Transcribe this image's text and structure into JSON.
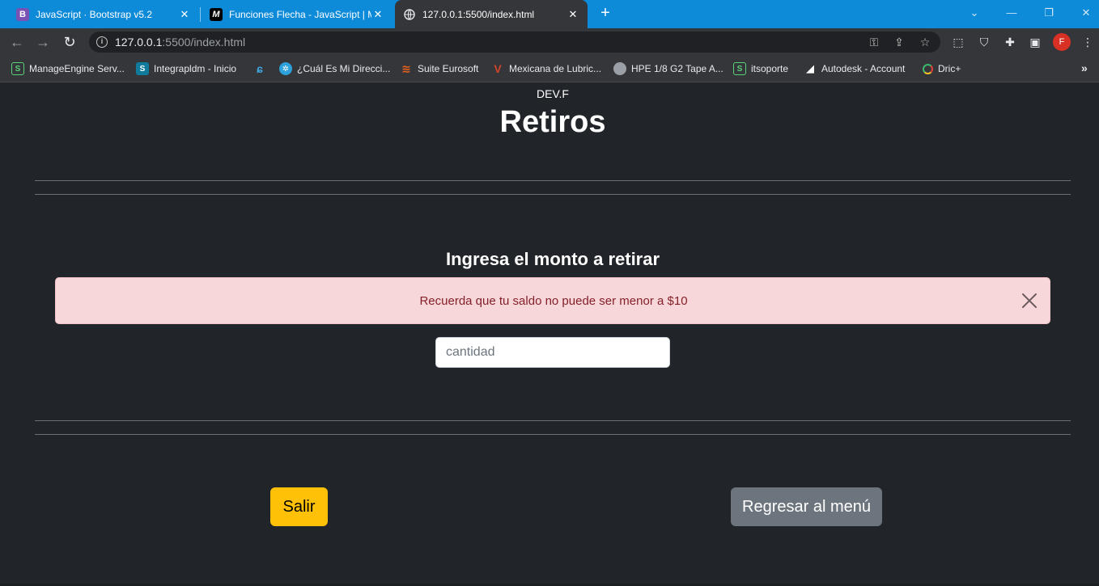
{
  "browser": {
    "tabs": [
      {
        "title": "JavaScript · Bootstrap v5.2",
        "icon": "bootstrap-icon",
        "icon_letter": "B",
        "active": false
      },
      {
        "title": "Funciones Flecha - JavaScript | M",
        "icon": "mdn-icon",
        "icon_letter": "M",
        "active": false
      },
      {
        "title": "127.0.0.1:5500/index.html",
        "icon": "globe-icon",
        "active": true
      }
    ],
    "new_tab_symbol": "+",
    "url_host": "127.0.0.1",
    "url_rest": ":5500/index.html",
    "profile_initial": "F",
    "bookmarks": [
      {
        "label": "ManageEngine Serv...",
        "icon": "manageengine-icon"
      },
      {
        "label": "Integrapldm - Inicio",
        "icon": "sharepoint-icon"
      },
      {
        "label": "",
        "icon": "edge-icon"
      },
      {
        "label": "¿Cuál Es Mi Direcci...",
        "icon": "ip-globe-icon"
      },
      {
        "label": "Suite Eurosoft",
        "icon": "eurosoft-icon"
      },
      {
        "label": "Mexicana de Lubric...",
        "icon": "vistony-icon"
      },
      {
        "label": "HPE 1/8 G2 Tape A...",
        "icon": "globe-icon"
      },
      {
        "label": "itsoporte",
        "icon": "manageengine-icon"
      },
      {
        "label": "Autodesk - Account",
        "icon": "autodesk-icon"
      },
      {
        "label": "Dric+",
        "icon": "dric-icon"
      }
    ]
  },
  "page": {
    "brand": "DEV.F",
    "title": "Retiros",
    "subtitle": "Ingresa el monto a retirar",
    "alert": {
      "text": "Recuerda que tu saldo no puede ser menor a $10",
      "color": "#f8d7da"
    },
    "amount_input": {
      "placeholder": "cantidad",
      "value": ""
    },
    "exit_button": "Salir",
    "menu_button": "Regresar al menú",
    "colors": {
      "background": "#212529",
      "warning": "#ffc107",
      "secondary": "#6c757d",
      "browser_accent": "#0d8ad8"
    }
  }
}
